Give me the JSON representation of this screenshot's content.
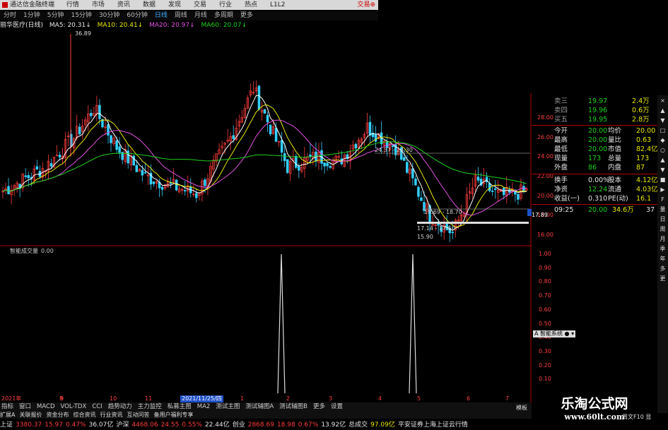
{
  "titlebar": {
    "app_name": "通达信金融终端",
    "menu": [
      "行情",
      "市场",
      "资讯",
      "数据",
      "发现",
      "交易",
      "行业",
      "热点",
      "L1L2"
    ],
    "right_label": "交易⊕"
  },
  "toolbar": {
    "periods": [
      "分时",
      "1分钟",
      "5分钟",
      "15分钟",
      "30分钟",
      "60分钟",
      "日线",
      "周线",
      "月线",
      "多周期",
      "更多"
    ],
    "active": "日线"
  },
  "ma_legend": {
    "stock_name": "丽华医疗(日线)",
    "ma5": "MA5: 20.31↓",
    "ma10": "MA10: 20.41↓",
    "ma20": "MA20: 20.97↓",
    "ma60": "MA60: 20.07↓"
  },
  "chart_data": [
    {
      "type": "candlestick",
      "title": "",
      "price_axis": [
        16.0,
        18.0,
        20.0,
        22.0,
        24.0,
        26.0,
        28.0
      ],
      "annotations": {
        "high_label": "36.89",
        "low_label": "15.90",
        "range1": "24.37 - 24.30",
        "range2": "18.69 - 18.70",
        "range3": "17.14 - 17.50",
        "current_price_tag": "17.89"
      },
      "series_colors": {
        "up": "#ff3c3c",
        "down": "#33d0ff",
        "ma5": "#ffffff",
        "ma10": "#e8e800",
        "ma20": "#e050e0",
        "ma60": "#1fd11f"
      }
    },
    {
      "type": "bar",
      "title": "智能成交量",
      "value_label": "0.00",
      "y_axis": [
        0.1,
        0.2,
        0.3,
        0.4,
        0.5,
        0.6,
        0.7,
        0.8,
        0.9,
        1.0
      ],
      "spikes": [
        1.0,
        1.0
      ]
    }
  ],
  "xaxis_dates": {
    "start": "2021年",
    "labels": [
      "8",
      "9",
      "10",
      "11",
      "2021/11/25/四",
      "1",
      "2",
      "3",
      "4",
      "5",
      "6",
      "7"
    ]
  },
  "panel": {
    "rows": [
      {
        "label": "卖三",
        "price": "19.97",
        "vol": "2.4万"
      },
      {
        "label": "卖四",
        "price": "19.96",
        "vol": "0.6万"
      },
      {
        "label": "买五",
        "price": "19.95",
        "vol": "2.8万"
      }
    ],
    "stats": [
      {
        "l1": "今开",
        "v1": "20.00",
        "l2": "均价",
        "v2": "20.00"
      },
      {
        "l1": "最高",
        "v1": "20.00",
        "l2": "量比",
        "v2": "0.63"
      },
      {
        "l1": "最低",
        "v1": "20.00",
        "l2": "市值",
        "v2": "82.4亿"
      },
      {
        "l1": "现量",
        "v1": "173",
        "l2": "总量",
        "v2": "173"
      },
      {
        "l1": "外盘",
        "v1": "86",
        "l2": "内盘",
        "v2": "87"
      }
    ],
    "stats2": [
      {
        "l1": "换手",
        "v1": "0.00%",
        "l2": "股本",
        "v2": "4.12亿"
      },
      {
        "l1": "净资",
        "v1": "12.24",
        "l2": "流通",
        "v2": "4.03亿"
      },
      {
        "l1": "收益(一)",
        "v1": "0.310",
        "l2": "PE(动)",
        "v2": "16.1"
      }
    ],
    "tick": {
      "time": "09:25",
      "price": "20.00",
      "vol": "34.6万",
      "n": "37"
    }
  },
  "strip_buttons": [
    "×",
    "▲",
    "▼",
    "□",
    "◆",
    "○",
    "▲",
    "▼",
    "■",
    "▶",
    "F",
    "量",
    "日",
    "周",
    "月",
    "季",
    "年",
    "多",
    "更"
  ],
  "side_popup": "A 智能系统 ● ▾",
  "tabs": [
    "指标",
    "窗口",
    "MACD",
    "VOL-TDX",
    "CCI",
    "趋势动力",
    "主力监控",
    "私募主图",
    "MA2",
    "测试主图",
    "测试辅图A",
    "测试辅图B",
    "更多",
    "设置"
  ],
  "tabs2": [
    "扩展A",
    "关联报价",
    "资金分布",
    "综合资讯",
    "行业资讯",
    "互动问答",
    "备用户福利专享"
  ],
  "tabs2_right": "模板",
  "status": [
    {
      "t": "上证",
      "c": "white"
    },
    {
      "t": "3380.37",
      "c": "red"
    },
    {
      "t": "15.97",
      "c": "red"
    },
    {
      "t": "0.47%",
      "c": "red"
    },
    {
      "t": "36.07亿",
      "c": "white"
    },
    {
      "t": "沪深",
      "c": "white"
    },
    {
      "t": "4468.06",
      "c": "red"
    },
    {
      "t": "24.55",
      "c": "red"
    },
    {
      "t": "0.55%",
      "c": "red"
    },
    {
      "t": "22.44亿",
      "c": "white"
    },
    {
      "t": "创业",
      "c": "white"
    },
    {
      "t": "2868.69",
      "c": "red"
    },
    {
      "t": "18.98",
      "c": "red"
    },
    {
      "t": "0.67%",
      "c": "red"
    },
    {
      "t": "13.92亿",
      "c": "white"
    },
    {
      "t": "总成交",
      "c": "white"
    },
    {
      "t": "97.09亿",
      "c": "yellow"
    },
    {
      "t": "平安证券上海上证云行情",
      "c": "white"
    }
  ],
  "bottom_right": "周文F10 显",
  "watermark": {
    "line1": "乐淘公式网",
    "line2": "www.60lt.com"
  }
}
